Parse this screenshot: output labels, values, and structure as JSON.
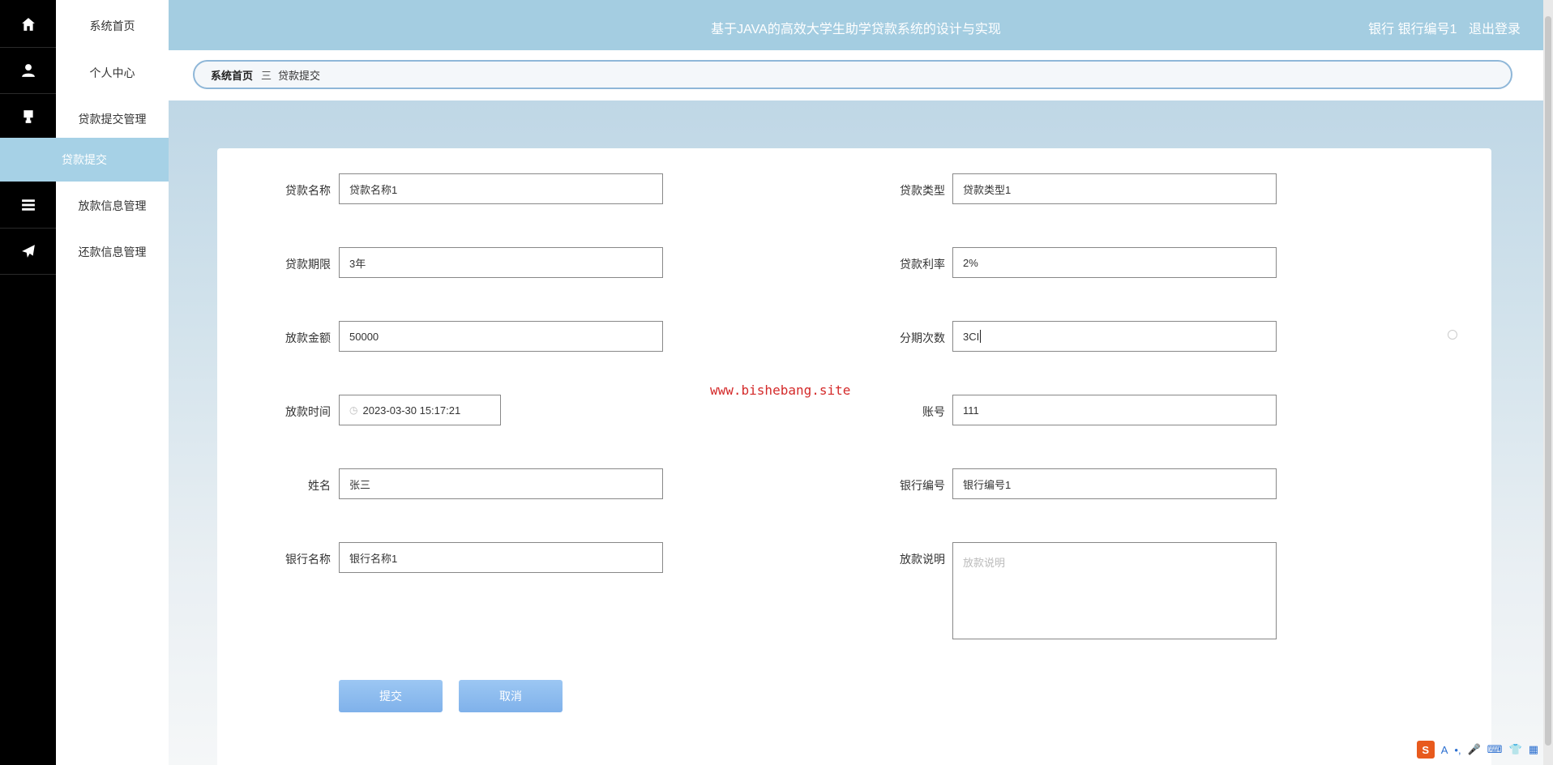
{
  "header": {
    "title": "基于JAVA的高效大学生助学贷款系统的设计与实现",
    "user": "银行 银行编号1",
    "logout": "退出登录"
  },
  "sidebar": {
    "items": [
      {
        "label": "系统首页",
        "icon": "home-icon"
      },
      {
        "label": "个人中心",
        "icon": "user-icon"
      },
      {
        "label": "贷款提交管理",
        "icon": "stamp-icon"
      },
      {
        "label": "放款信息管理",
        "icon": "list-icon"
      },
      {
        "label": "还款信息管理",
        "icon": "send-icon"
      }
    ],
    "subitem": "贷款提交"
  },
  "breadcrumb": {
    "home": "系统首页",
    "separator": "三",
    "current": "贷款提交"
  },
  "form": {
    "loan_name": {
      "label": "贷款名称",
      "value": "贷款名称1"
    },
    "loan_type": {
      "label": "贷款类型",
      "value": "贷款类型1"
    },
    "loan_term": {
      "label": "贷款期限",
      "value": "3年"
    },
    "loan_rate": {
      "label": "贷款利率",
      "value": "2%"
    },
    "amount": {
      "label": "放款金额",
      "value": "50000"
    },
    "installments": {
      "label": "分期次数",
      "value": "3CI"
    },
    "release_time": {
      "label": "放款时间",
      "value": "2023-03-30 15:17:21"
    },
    "account": {
      "label": "账号",
      "value": "111"
    },
    "name": {
      "label": "姓名",
      "value": "张三"
    },
    "bank_code": {
      "label": "银行编号",
      "value": "银行编号1"
    },
    "bank_name": {
      "label": "银行名称",
      "value": "银行名称1"
    },
    "release_note": {
      "label": "放款说明",
      "placeholder": "放款说明"
    },
    "submit": "提交",
    "cancel": "取消"
  },
  "watermark": "www.bishebang.site",
  "ime": {
    "logo": "S",
    "mode": "A"
  }
}
